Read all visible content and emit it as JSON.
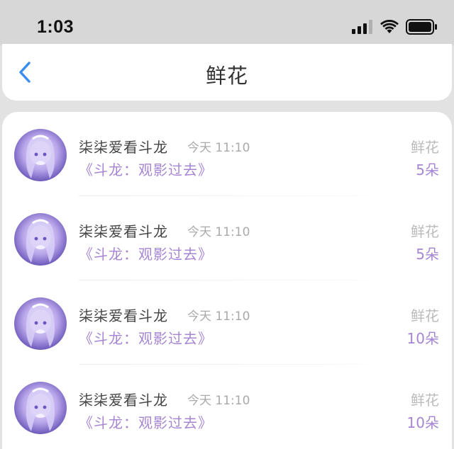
{
  "status_bar": {
    "time": "1:03",
    "icons": [
      "signal-icon",
      "wifi-icon",
      "battery-icon"
    ]
  },
  "nav": {
    "back_icon": "chevron-left-icon",
    "title": "鲜花"
  },
  "colors": {
    "accent": "#a686d3",
    "back": "#3a8ef0"
  },
  "items": [
    {
      "user": "柒柒爱看斗龙",
      "time": "今天 11:10",
      "title": "《斗龙：观影过去》",
      "gift": "鲜花",
      "count": "5朵"
    },
    {
      "user": "柒柒爱看斗龙",
      "time": "今天 11:10",
      "title": "《斗龙：观影过去》",
      "gift": "鲜花",
      "count": "5朵"
    },
    {
      "user": "柒柒爱看斗龙",
      "time": "今天 11:10",
      "title": "《斗龙：观影过去》",
      "gift": "鲜花",
      "count": "10朵"
    },
    {
      "user": "柒柒爱看斗龙",
      "time": "今天 11:10",
      "title": "《斗龙：观影过去》",
      "gift": "鲜花",
      "count": "10朵"
    }
  ]
}
